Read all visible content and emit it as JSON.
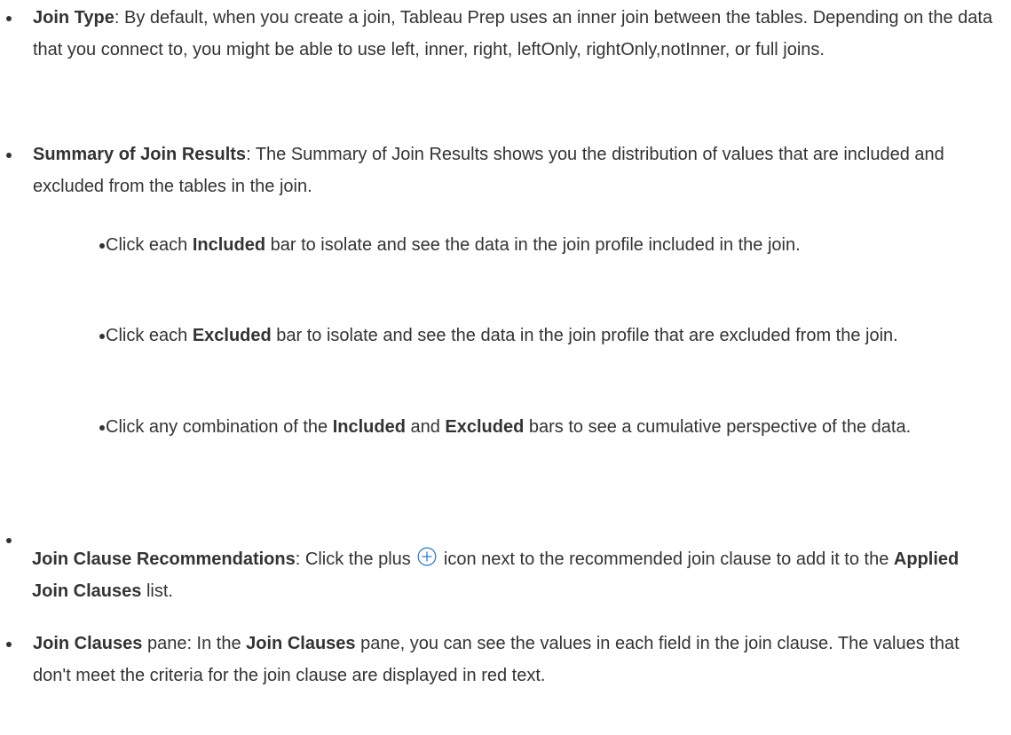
{
  "items": [
    {
      "title": "Join Type",
      "sep": ":",
      "text": " By default, when you create a join, Tableau Prep uses an inner join between the tables. Depending on the data that you connect to, you might be able to use left, inner, right, leftOnly, rightOnly,notInner, or full joins."
    },
    {
      "title": "Summary of Join Results",
      "sep": ":",
      "text": " The Summary of Join Results shows you the distribution of values that are included and excluded from the tables in the join.",
      "subitems": [
        {
          "pre": "Click each ",
          "bold": "Included",
          "post": " bar to isolate and see the data in the join profile included in the join."
        },
        {
          "pre": "Click each ",
          "bold": "Excluded",
          "post": " bar to isolate and see the data in the join profile that are excluded from the join."
        },
        {
          "pre": "Click any combination of the ",
          "bold1": "Included",
          "mid": " and ",
          "bold2": "Excluded",
          "post": " bars to see a cumulative perspective of the data."
        }
      ]
    },
    {
      "title": "Join Clause Recommendations",
      "sep": ":",
      "pre": " Click the plus ",
      "icon": "plus-circle-icon",
      "mid": " icon next to the recommended join clause to add it to the ",
      "bold": "Applied Join Clauses",
      "post": " list."
    },
    {
      "title": "Join Clauses",
      "pre": " pane: In the ",
      "bold": "Join Clauses",
      "post": " pane, you can see the values in each field in the join clause. The values that don't meet the criteria for the join clause are displayed in red text."
    }
  ],
  "colors": {
    "text": "#333333",
    "icon": "#2f7fd0"
  }
}
